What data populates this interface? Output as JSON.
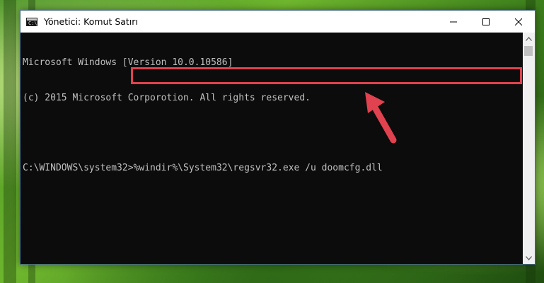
{
  "window": {
    "title": "Yönetici: Komut Satırı",
    "icon": "cmd-icon",
    "controls": [
      "minimize-icon",
      "maximize-icon",
      "close-icon"
    ]
  },
  "console": {
    "lines": [
      "Microsoft Windows [Version 10.0.10586]",
      "(c) 2015 Microsoft Corporotion. All rights reserved.",
      ""
    ],
    "prompt": "C:\\WINDOWS\\system32>",
    "command": "%windir%\\System32\\regsvr32.exe /u doomcfg.dll"
  },
  "annotation": {
    "highlight_color": "#e0424f",
    "arrow_color": "#e0424f"
  },
  "colors": {
    "console_bg": "#0c0c0c",
    "console_text": "#c0c0c0",
    "titlebar_bg": "#ffffff"
  }
}
